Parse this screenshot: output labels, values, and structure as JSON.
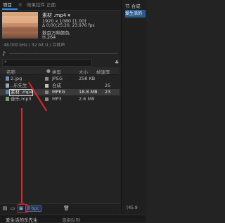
{
  "tabs": [
    {
      "label": "项目"
    },
    {
      "label": "效果控件 正面"
    },
    {
      "label": "≡"
    }
  ],
  "right_pane": {
    "top_label": "节 合成",
    "highlight": "爱生活的"
  },
  "asset_info": {
    "name": "素材 .mp4 ▾",
    "resolution": "1920 x 1080 (1.00)",
    "timing": "Δ 0;00;25;20, 23.976 fps",
    "color": "数百万种颜色",
    "codec": "H.264",
    "audio": "48.000 kHz / 32 bit U / 立体声"
  },
  "table": {
    "headers": {
      "name": "名称",
      "type": "类型",
      "size": "大小",
      "rate": "帧速率"
    },
    "rows": [
      {
        "name": "2.jpg",
        "type": "JPEG",
        "size": "258 KB",
        "rate": "",
        "color": "#8a8a8a"
      },
      {
        "name": "..乐先生",
        "type": "合成",
        "size": "",
        "rate": "25",
        "color": "#c9c1a3"
      },
      {
        "name": "素材 .mp4",
        "type": "MPEG",
        "size": "18.8 MB",
        "rate": "23",
        "color": "#8a8a8a",
        "selected": true
      },
      {
        "name": "音乐.mp3",
        "type": "MP3",
        "size": "2.6 MB",
        "rate": "",
        "color": "#8a8a8a"
      }
    ]
  },
  "bottom": {
    "bpc": "8 bpc",
    "zoom": "(45.9"
  },
  "timeline_tabs": [
    {
      "label": "爱生活的乐先生"
    },
    {
      "label": "渲染队列"
    }
  ]
}
